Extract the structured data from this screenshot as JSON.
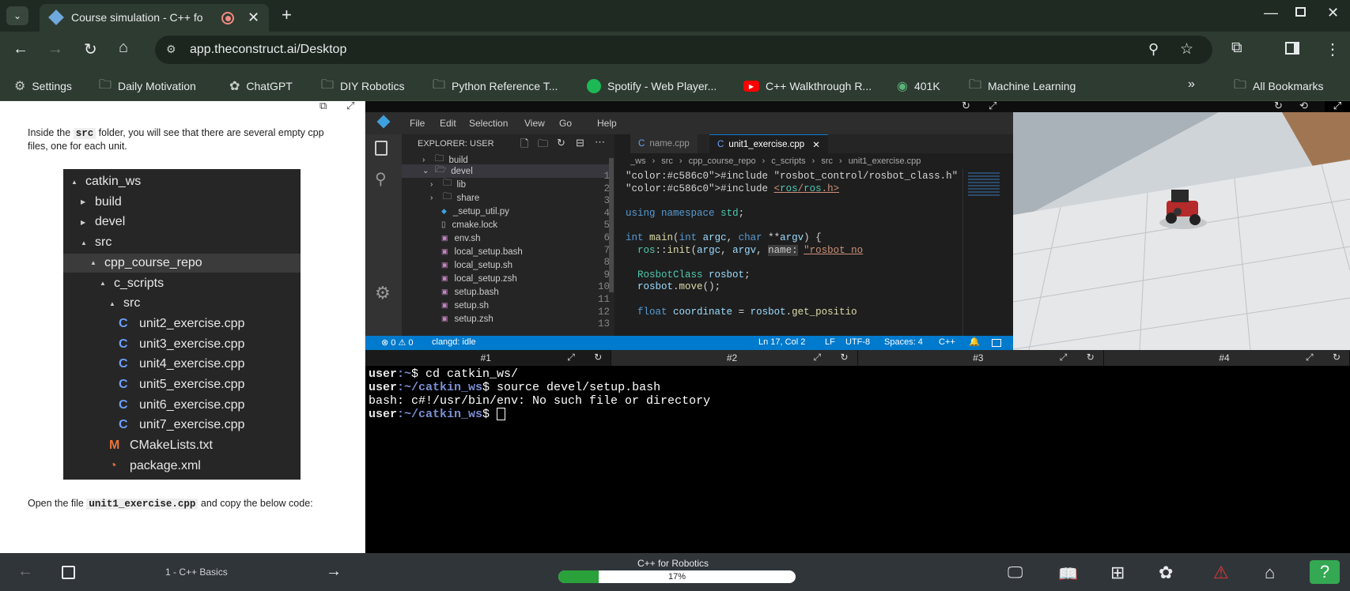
{
  "browser": {
    "tab_title": "Course simulation - C++ fo",
    "url": "app.theconstruct.ai/Desktop",
    "bookmarks": [
      {
        "label": "Settings",
        "icon": "gear-icon"
      },
      {
        "label": "Daily Motivation",
        "icon": "folder-icon"
      },
      {
        "label": "ChatGPT",
        "icon": "chatgpt-icon"
      },
      {
        "label": "DIY Robotics",
        "icon": "folder-icon"
      },
      {
        "label": "Python Reference T...",
        "icon": "folder-icon"
      },
      {
        "label": "Spotify - Web Player...",
        "icon": "spotify-icon"
      },
      {
        "label": "C++ Walkthrough R...",
        "icon": "youtube-icon"
      },
      {
        "label": "401K",
        "icon": "vanguard-icon"
      },
      {
        "label": "Machine Learning",
        "icon": "folder-icon"
      }
    ],
    "all_bookmarks": "All Bookmarks"
  },
  "notebook": {
    "intro_pre": "Inside the ",
    "intro_code": "src",
    "intro_post": " folder, you will see that there are several empty cpp files, one for each unit.",
    "tree": [
      {
        "label": "catkin_ws",
        "arrow": "▲"
      },
      {
        "label": "build",
        "arrow": "▶"
      },
      {
        "label": "devel",
        "arrow": "▶"
      },
      {
        "label": "src",
        "arrow": "▲"
      },
      {
        "label": "cpp_course_repo",
        "arrow": "▲"
      },
      {
        "label": "c_scripts",
        "arrow": "▲"
      },
      {
        "label": "src",
        "arrow": "▲"
      },
      {
        "label": "unit2_exercise.cpp",
        "icon": "C"
      },
      {
        "label": "unit3_exercise.cpp",
        "icon": "C"
      },
      {
        "label": "unit4_exercise.cpp",
        "icon": "C"
      },
      {
        "label": "unit5_exercise.cpp",
        "icon": "C"
      },
      {
        "label": "unit6_exercise.cpp",
        "icon": "C"
      },
      {
        "label": "unit7_exercise.cpp",
        "icon": "C"
      },
      {
        "label": "CMakeLists.txt",
        "icon": "M"
      },
      {
        "label": "package.xml",
        "icon": "rss"
      }
    ],
    "open_pre": "Open the file ",
    "open_code": "unit1_exercise.cpp",
    "open_post": " and copy the below code:"
  },
  "vscode": {
    "menu": [
      "File",
      "Edit",
      "Selection",
      "View",
      "Go",
      "Help"
    ],
    "explorer_title": "EXPLORER: USER",
    "explorer_items": [
      {
        "label": "build",
        "type": "folder-closed"
      },
      {
        "label": "devel",
        "type": "folder-open"
      },
      {
        "label": "lib",
        "type": "folder-closed"
      },
      {
        "label": "share",
        "type": "folder-closed"
      },
      {
        "label": "_setup_util.py",
        "type": "python"
      },
      {
        "label": "cmake.lock",
        "type": "file"
      },
      {
        "label": "env.sh",
        "type": "shell"
      },
      {
        "label": "local_setup.bash",
        "type": "shell"
      },
      {
        "label": "local_setup.sh",
        "type": "shell"
      },
      {
        "label": "local_setup.zsh",
        "type": "shell"
      },
      {
        "label": "setup.bash",
        "type": "shell"
      },
      {
        "label": "setup.sh",
        "type": "shell"
      },
      {
        "label": "setup.zsh",
        "type": "shell"
      }
    ],
    "tabs": [
      {
        "label": "name.cpp"
      },
      {
        "label": "unit1_exercise.cpp"
      }
    ],
    "breadcrumb": [
      "_ws",
      "src",
      "cpp_course_repo",
      "c_scripts",
      "src",
      "unit1_exercise.cpp"
    ],
    "code": [
      {
        "n": "1",
        "text": "#include \"rosbot_control/rosbot_class.h\""
      },
      {
        "n": "2",
        "text": "#include <ros/ros.h>"
      },
      {
        "n": "3",
        "text": ""
      },
      {
        "n": "4",
        "text": "using namespace std;"
      },
      {
        "n": "5",
        "text": ""
      },
      {
        "n": "6",
        "text": "int main(int argc, char **argv) {"
      },
      {
        "n": "7",
        "text": "  ros::init(argc, argv, name: \"rosbot_no"
      },
      {
        "n": "8",
        "text": ""
      },
      {
        "n": "9",
        "text": "  RosbotClass rosbot;"
      },
      {
        "n": "10",
        "text": "  rosbot.move();"
      },
      {
        "n": "11",
        "text": ""
      },
      {
        "n": "12",
        "text": "  float coordinate = rosbot.get_positio"
      },
      {
        "n": "13",
        "text": ""
      }
    ],
    "status": {
      "problems": "⊗ 0 ⚠ 0",
      "lsp": "clangd: idle",
      "position": "Ln 17, Col 2",
      "eol": "LF",
      "encoding": "UTF-8",
      "indent": "Spaces: 4",
      "language": "C++"
    }
  },
  "terminals": {
    "tabs": [
      "#1",
      "#2",
      "#3",
      "#4"
    ],
    "lines": [
      {
        "prompt": "user",
        "path": ":~",
        "cmd": "$ cd catkin_ws/"
      },
      {
        "prompt": "user",
        "path": ":~/catkin_ws",
        "cmd": "$ source devel/setup.bash"
      },
      {
        "prompt": "",
        "path": "",
        "cmd": "bash: c#!/usr/bin/env: No such file or directory"
      },
      {
        "prompt": "user",
        "path": ":~/catkin_ws",
        "cmd": "$ "
      }
    ]
  },
  "footer": {
    "unit": "1 - C++ Basics",
    "course": "C++ for Robotics",
    "progress_label": "17%",
    "progress": 0.17
  },
  "colors": {
    "accent_green": "#2aa13a",
    "vscode_blue": "#007acc",
    "help_green": "#34a853",
    "warning_red": "#e53935"
  }
}
